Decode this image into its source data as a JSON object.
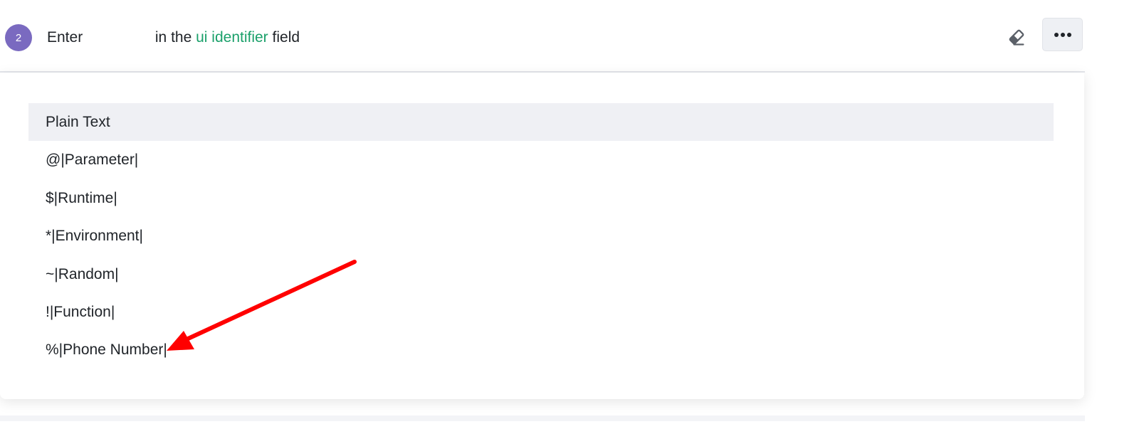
{
  "step": {
    "number": "2",
    "verb": "Enter",
    "value": "",
    "middle_text": "in the",
    "target_link": "ui identifier",
    "suffix_text": "field"
  },
  "toolbar": {
    "eraser_icon": "eraser-icon",
    "more_icon": "ellipsis-icon"
  },
  "dropdown": {
    "selected_index": 0,
    "options": [
      {
        "label": "Plain Text"
      },
      {
        "label": "@|Parameter|"
      },
      {
        "label": "$|Runtime|"
      },
      {
        "label": "*|Environment|"
      },
      {
        "label": "~|Random|"
      },
      {
        "label": "!|Function|"
      },
      {
        "label": "%|Phone Number|"
      }
    ]
  },
  "colors": {
    "badge": "#7a6ac0",
    "link": "#1aa06a",
    "highlight": "#eff0f4",
    "annotation_arrow": "#ff0000"
  }
}
